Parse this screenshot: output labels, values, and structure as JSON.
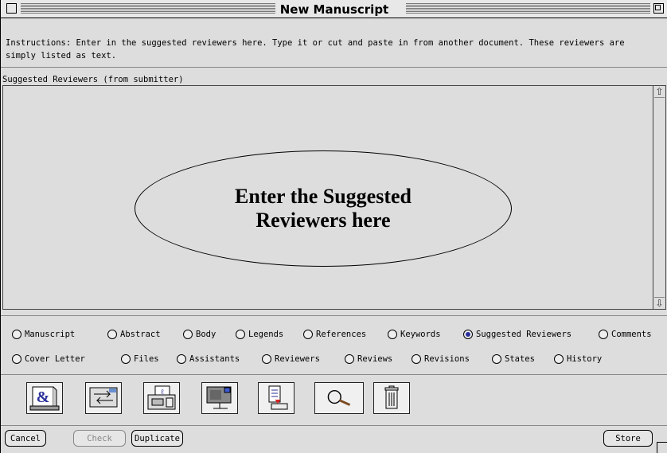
{
  "window": {
    "title": "New Manuscript"
  },
  "instructions": {
    "text": "Instructions: Enter in the suggested reviewers here. Type it or cut and paste in from another document. These reviewers are simply listed as text."
  },
  "field": {
    "label": "Suggested Reviewers (from submitter)",
    "value": ""
  },
  "callout": {
    "line1": "Enter the Suggested",
    "line2": "Reviewers here"
  },
  "sections": {
    "row1": [
      "Manuscript",
      "Abstract",
      "Body",
      "Legends",
      "References",
      "Keywords",
      "Suggested Reviewers",
      "Comments"
    ],
    "row2": [
      "Cover Letter",
      "Files",
      "Assistants",
      "Reviewers",
      "Reviews",
      "Revisions",
      "States",
      "History"
    ],
    "selected": "Suggested Reviewers"
  },
  "toolbar": {
    "icons": [
      "ampersand-doc-icon",
      "transfer-icon",
      "print-fax-icon",
      "mail-server-icon",
      "document-export-icon",
      "magnifier-icon",
      "trash-icon"
    ]
  },
  "buttons": {
    "cancel": "Cancel",
    "check": "Check",
    "duplicate": "Duplicate",
    "store": "Store"
  }
}
